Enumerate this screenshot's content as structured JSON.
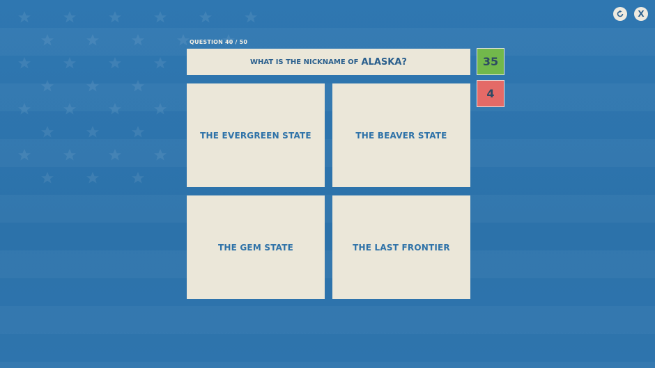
{
  "header": {
    "reset_icon": "refresh-icon",
    "close_label": "X"
  },
  "question": {
    "counter": "QUESTION 40 / 50",
    "prefix": "WHAT IS THE NICKNAME OF",
    "keyword": "ALASKA?"
  },
  "score": {
    "correct": "35",
    "wrong": "4",
    "correct_color": "#72b84b",
    "wrong_color": "#e46a67"
  },
  "answers": [
    {
      "label": "THE EVERGREEN STATE"
    },
    {
      "label": "THE BEAVER STATE"
    },
    {
      "label": "THE GEM STATE"
    },
    {
      "label": "THE LAST FRONTIER"
    }
  ]
}
